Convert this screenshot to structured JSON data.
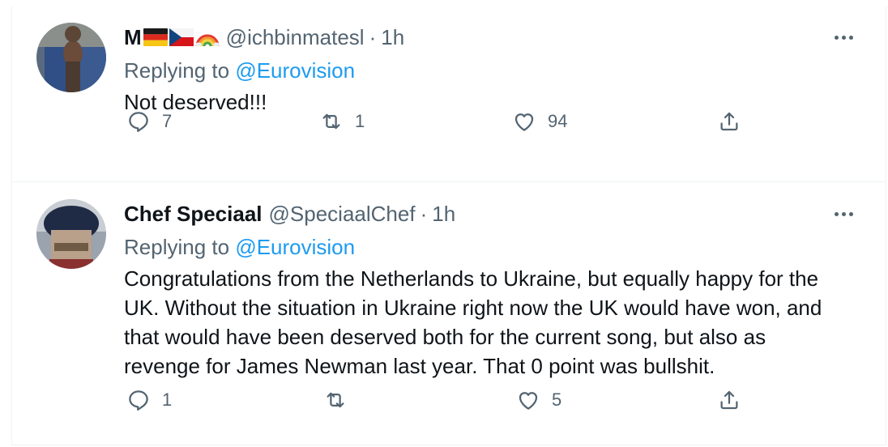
{
  "tweets": [
    {
      "name_prefix": "M",
      "name_emojis": [
        "german-flag",
        "czech-flag",
        "rainbow"
      ],
      "handle": "@ichbinmatesl",
      "separator": "·",
      "time": "1h",
      "replying_prefix": "Replying to ",
      "replying_to": "@Eurovision",
      "text": "Not deserved!!!",
      "reply_count": "7",
      "retweet_count": "1",
      "like_count": "94"
    },
    {
      "name": "Chef Speciaal",
      "handle": "@SpeciaalChef",
      "separator": "·",
      "time": "1h",
      "replying_prefix": "Replying to ",
      "replying_to": "@Eurovision",
      "text": "Congratulations from the Netherlands to Ukraine, but equally happy for the\nUK. Without the situation in Ukraine right now the UK would have won, and\nthat would have been deserved both for the current song, but also as\nrevenge for James Newman last year. That 0 point was bullshit.",
      "reply_count": "1",
      "retweet_count": "",
      "like_count": "5"
    }
  ],
  "colors": {
    "text": "#0f1419",
    "secondary": "#536471",
    "link": "#1d9bf0",
    "border": "#eff3f4"
  }
}
